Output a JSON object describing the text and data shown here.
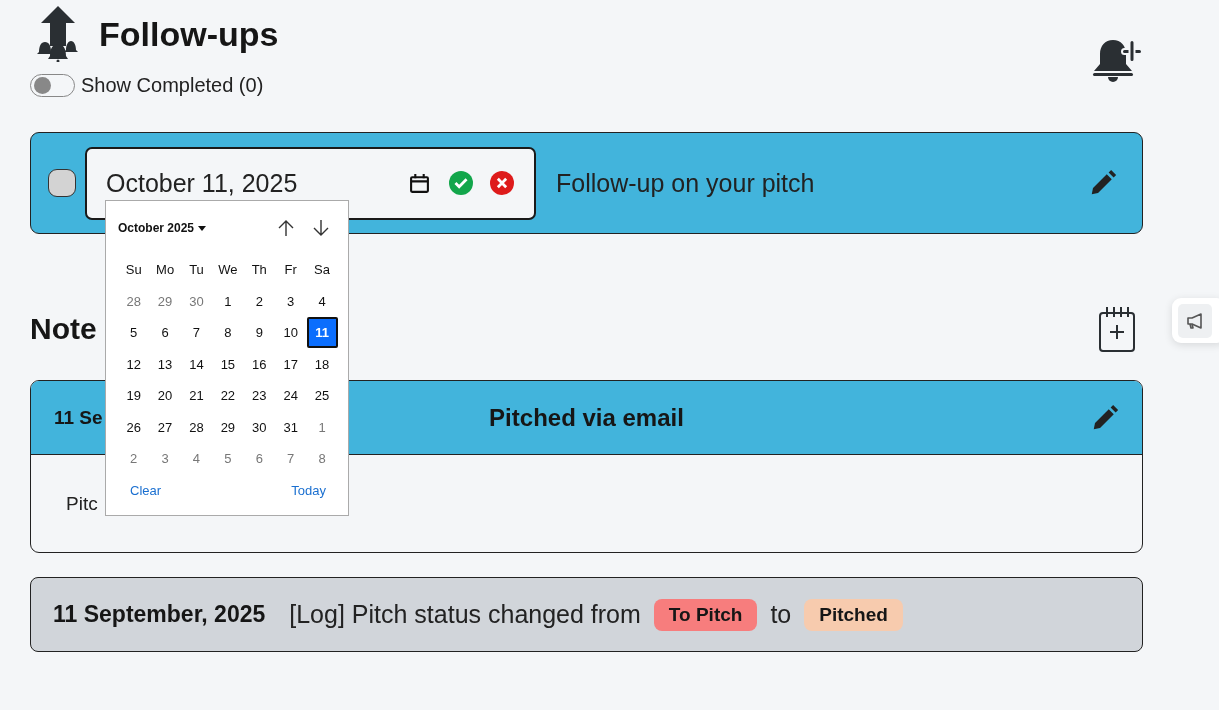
{
  "header": {
    "title": "Follow-ups",
    "toggle": {
      "label": "Show Completed (0)",
      "on": false
    }
  },
  "followups": [
    {
      "checked": false,
      "date": "October 11, 2025",
      "title": "Follow-up on your pitch"
    }
  ],
  "datepicker": {
    "month": "October 2025",
    "weekdays": [
      "Su",
      "Mo",
      "Tu",
      "We",
      "Th",
      "Fr",
      "Sa"
    ],
    "weeks": [
      [
        {
          "label": "28",
          "muted": true,
          "selected": false
        },
        {
          "label": "29",
          "muted": true,
          "selected": false
        },
        {
          "label": "30",
          "muted": true,
          "selected": false
        },
        {
          "label": "1",
          "muted": false,
          "selected": false
        },
        {
          "label": "2",
          "muted": false,
          "selected": false
        },
        {
          "label": "3",
          "muted": false,
          "selected": false
        },
        {
          "label": "4",
          "muted": false,
          "selected": false
        }
      ],
      [
        {
          "label": "5",
          "muted": false,
          "selected": false
        },
        {
          "label": "6",
          "muted": false,
          "selected": false
        },
        {
          "label": "7",
          "muted": false,
          "selected": false
        },
        {
          "label": "8",
          "muted": false,
          "selected": false
        },
        {
          "label": "9",
          "muted": false,
          "selected": false
        },
        {
          "label": "10",
          "muted": false,
          "selected": false
        },
        {
          "label": "11",
          "muted": false,
          "selected": true
        }
      ],
      [
        {
          "label": "12",
          "muted": false,
          "selected": false
        },
        {
          "label": "13",
          "muted": false,
          "selected": false
        },
        {
          "label": "14",
          "muted": false,
          "selected": false
        },
        {
          "label": "15",
          "muted": false,
          "selected": false
        },
        {
          "label": "16",
          "muted": false,
          "selected": false
        },
        {
          "label": "17",
          "muted": false,
          "selected": false
        },
        {
          "label": "18",
          "muted": false,
          "selected": false
        }
      ],
      [
        {
          "label": "19",
          "muted": false,
          "selected": false
        },
        {
          "label": "20",
          "muted": false,
          "selected": false
        },
        {
          "label": "21",
          "muted": false,
          "selected": false
        },
        {
          "label": "22",
          "muted": false,
          "selected": false
        },
        {
          "label": "23",
          "muted": false,
          "selected": false
        },
        {
          "label": "24",
          "muted": false,
          "selected": false
        },
        {
          "label": "25",
          "muted": false,
          "selected": false
        }
      ],
      [
        {
          "label": "26",
          "muted": false,
          "selected": false
        },
        {
          "label": "27",
          "muted": false,
          "selected": false
        },
        {
          "label": "28",
          "muted": false,
          "selected": false
        },
        {
          "label": "29",
          "muted": false,
          "selected": false
        },
        {
          "label": "30",
          "muted": false,
          "selected": false
        },
        {
          "label": "31",
          "muted": false,
          "selected": false
        },
        {
          "label": "1",
          "muted": true,
          "selected": false
        }
      ],
      [
        {
          "label": "2",
          "muted": true,
          "selected": false
        },
        {
          "label": "3",
          "muted": true,
          "selected": false
        },
        {
          "label": "4",
          "muted": true,
          "selected": false
        },
        {
          "label": "5",
          "muted": true,
          "selected": false
        },
        {
          "label": "6",
          "muted": true,
          "selected": false
        },
        {
          "label": "7",
          "muted": true,
          "selected": false
        },
        {
          "label": "8",
          "muted": true,
          "selected": false
        }
      ]
    ],
    "clear": "Clear",
    "today": "Today"
  },
  "notes": {
    "title": "Note",
    "cards": [
      {
        "kind": "note",
        "date": "11 Se",
        "title": "Pitched via email",
        "body": "Pitc"
      },
      {
        "kind": "log",
        "date": "11 September, 2025",
        "text": "[Log] Pitch status changed from",
        "from": {
          "label": "To Pitch",
          "color": "#f77d7d"
        },
        "joiner": "to",
        "to": {
          "label": "Pitched",
          "color": "#f7cbae"
        }
      }
    ]
  }
}
